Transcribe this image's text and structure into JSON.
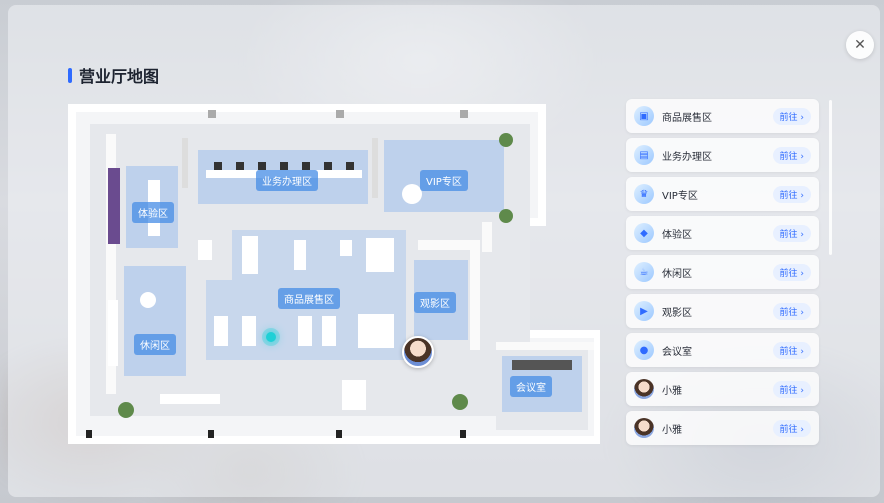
{
  "page": {
    "title": "营业厅地图",
    "close_icon": "close-icon"
  },
  "map": {
    "zones": {
      "business": "业务办理区",
      "vip": "VIP专区",
      "experience": "体验区",
      "product": "商品展售区",
      "movie": "观影区",
      "leisure": "休闲区",
      "meeting": "会议室"
    }
  },
  "list": {
    "items": [
      {
        "label": "商品展售区",
        "action": "前往 ›",
        "icon": "product-icon"
      },
      {
        "label": "业务办理区",
        "action": "前往 ›",
        "icon": "business-icon"
      },
      {
        "label": "VIP专区",
        "action": "前往 ›",
        "icon": "vip-icon"
      },
      {
        "label": "体验区",
        "action": "前往 ›",
        "icon": "experience-icon"
      },
      {
        "label": "休闲区",
        "action": "前往 ›",
        "icon": "leisure-icon"
      },
      {
        "label": "观影区",
        "action": "前往 ›",
        "icon": "movie-icon"
      },
      {
        "label": "会议室",
        "action": "前往 ›",
        "icon": "meeting-icon"
      },
      {
        "label": "小雅",
        "action": "前往 ›",
        "icon": "avatar-icon"
      },
      {
        "label": "小雅",
        "action": "前往 ›",
        "icon": "avatar-icon"
      }
    ]
  },
  "colors": {
    "accent": "#2f6bff",
    "zone_fill": "#8fb6ee",
    "wall": "#ffffff",
    "floor": "#e9ebee"
  }
}
